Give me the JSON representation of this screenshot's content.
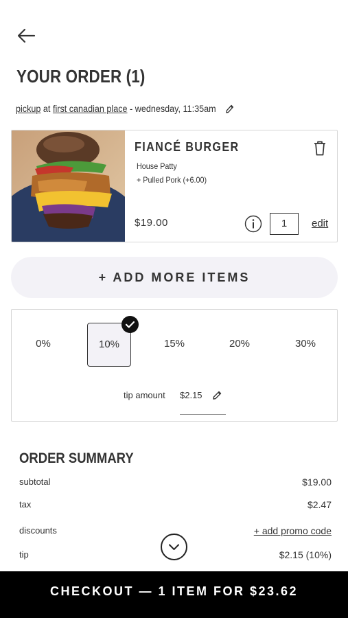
{
  "header": {
    "title": "YOUR ORDER (1)"
  },
  "pickup": {
    "method": "pickup",
    "at_word": "at",
    "location": "first canadian place",
    "time": "- wednesday, 11:35am"
  },
  "cart": {
    "item": {
      "name": "FIANCÉ BURGER",
      "modifiers": [
        "House Patty",
        "+ Pulled Pork (+6.00)"
      ],
      "price": "$19.00",
      "quantity": "1",
      "edit_label": "edit"
    }
  },
  "actions": {
    "add_more": "+ ADD MORE ITEMS"
  },
  "tip": {
    "options": [
      "0%",
      "10%",
      "15%",
      "20%",
      "30%"
    ],
    "selected": "10%",
    "amount_label": "tip amount",
    "amount_value": "$2.15"
  },
  "summary": {
    "title": "ORDER SUMMARY",
    "rows": [
      {
        "label": "subtotal",
        "value": "$19.00"
      },
      {
        "label": "tax",
        "value": "$2.47"
      },
      {
        "label": "discounts",
        "value": "+ add promo code"
      },
      {
        "label": "tip",
        "value": "$2.15 (10%)"
      }
    ]
  },
  "checkout": {
    "label": "CHECKOUT — 1 ITEM FOR $23.62"
  },
  "icons": {
    "back": "arrow-left-icon",
    "edit": "pencil-icon",
    "delete": "trash-icon",
    "info": "info-icon",
    "selected": "checkmark-icon",
    "scroll": "chevron-down-icon"
  },
  "colors": {
    "accent_bg": "#f3f2f7",
    "checkout_bg": "#000000",
    "text": "#333333"
  }
}
